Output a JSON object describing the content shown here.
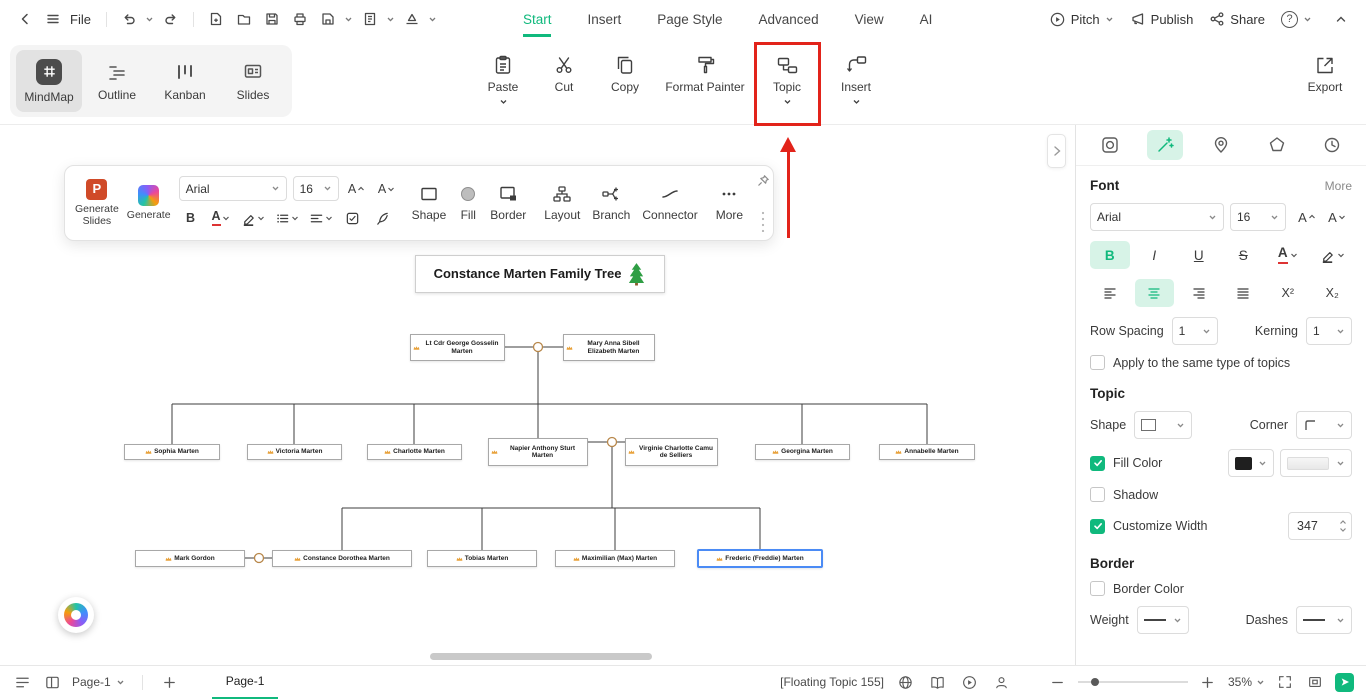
{
  "topbar": {
    "file_label": "File",
    "help_glyph": "?",
    "tabs": [
      {
        "label": "Start"
      },
      {
        "label": "Insert"
      },
      {
        "label": "Page Style"
      },
      {
        "label": "Advanced"
      },
      {
        "label": "View"
      },
      {
        "label": "AI"
      }
    ],
    "pitch_label": "Pitch",
    "publish_label": "Publish",
    "share_label": "Share"
  },
  "ribbon": {
    "views": [
      {
        "label": "MindMap"
      },
      {
        "label": "Outline"
      },
      {
        "label": "Kanban"
      },
      {
        "label": "Slides"
      }
    ],
    "paste_label": "Paste",
    "cut_label": "Cut",
    "copy_label": "Copy",
    "format_painter_label": "Format Painter",
    "topic_label": "Topic",
    "insert_label": "Insert",
    "export_label": "Export"
  },
  "floating_toolbar": {
    "generate_slides_label": "Generate Slides",
    "generate_label": "Generate",
    "ppt_glyph": "P",
    "font_family": "Arial",
    "font_size": "16",
    "increase_font_glyph": "A",
    "decrease_font_glyph": "A",
    "bold_glyph": "B",
    "font_color_glyph": "A",
    "shape_label": "Shape",
    "fill_label": "Fill",
    "border_label": "Border",
    "layout_label": "Layout",
    "branch_label": "Branch",
    "connector_label": "Connector",
    "more_label": "More"
  },
  "canvas": {
    "title": "Constance Marten Family Tree",
    "title_icon": "christmas-tree-icon",
    "node_icon": "crown-icon",
    "nodes": [
      {
        "name": "Lt Cdr George Gosselin Marten"
      },
      {
        "name": "Mary Anna Sibell Elizabeth Marten"
      },
      {
        "name": "Sophia Marten"
      },
      {
        "name": "Victoria Marten"
      },
      {
        "name": "Charlotte Marten"
      },
      {
        "name": "Napier Anthony Sturt Marten"
      },
      {
        "name": "Virginie Charlotte Camu de Selliers"
      },
      {
        "name": "Georgina Marten"
      },
      {
        "name": "Annabelle Marten"
      },
      {
        "name": "Mark Gordon"
      },
      {
        "name": "Constance Dorothea Marten"
      },
      {
        "name": "Tobias Marten"
      },
      {
        "name": "Maximilian (Max) Marten"
      },
      {
        "name": "Frederic (Freddie) Marten"
      }
    ]
  },
  "right_panel": {
    "font": {
      "header": "Font",
      "more_label": "More",
      "family": "Arial",
      "size": "16",
      "increase_glyph": "A",
      "decrease_glyph": "A",
      "bold_glyph": "B",
      "italic_glyph": "I",
      "underline_glyph": "U",
      "strike_glyph": "S",
      "color_glyph": "A",
      "superscript_glyph": "X²",
      "subscript_glyph": "X₂",
      "row_spacing_label": "Row Spacing",
      "row_spacing_value": "1",
      "kerning_label": "Kerning",
      "kerning_value": "1",
      "apply_label": "Apply to the same type of topics"
    },
    "topic": {
      "header": "Topic",
      "shape_label": "Shape",
      "corner_label": "Corner",
      "fill_color_label": "Fill Color",
      "shadow_label": "Shadow",
      "customize_width_label": "Customize Width",
      "customize_width_value": "347"
    },
    "border": {
      "header": "Border",
      "border_color_label": "Border Color",
      "weight_label": "Weight",
      "dashes_label": "Dashes"
    }
  },
  "statusbar": {
    "page_selector_label": "Page-1",
    "page_tab_label": "Page-1",
    "floating_topic_label": "[Floating Topic 155]",
    "zoom_value": "35%"
  },
  "colors": {
    "accent_green": "#10b97d",
    "annotation_red": "#e2231a",
    "selection_blue": "#4b8bf5"
  }
}
